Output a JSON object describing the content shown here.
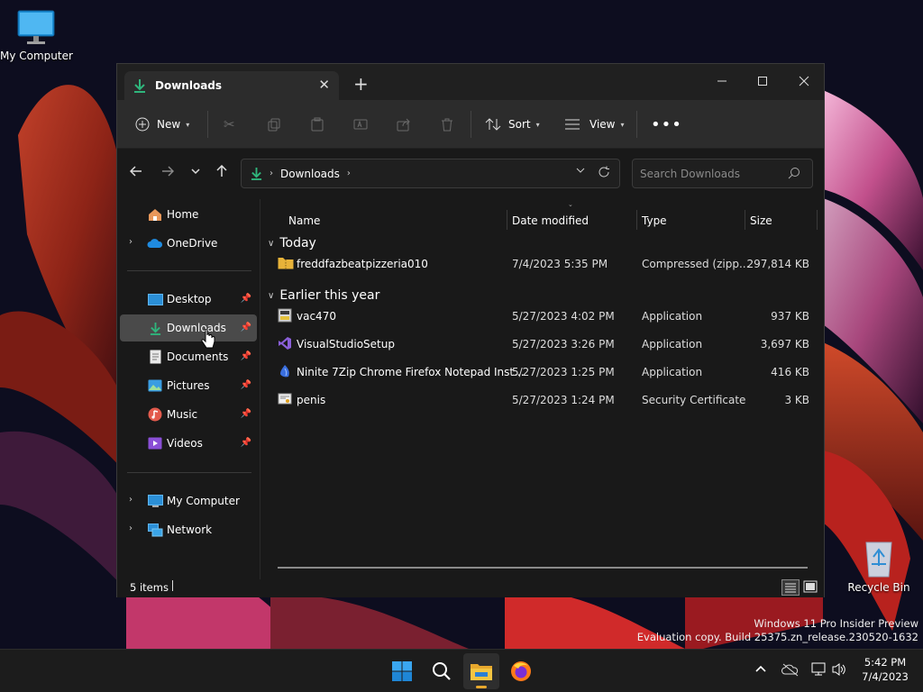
{
  "desktop": {
    "icons": [
      {
        "label": "My Computer"
      },
      {
        "label": "Recycle Bin"
      }
    ],
    "watermark": {
      "line1": "Windows 11 Pro Insider Preview",
      "line2": "Evaluation copy. Build 25375.zn_release.230520-1632"
    }
  },
  "window": {
    "tab_title": "Downloads",
    "commands": {
      "new_label": "New",
      "sort_label": "Sort",
      "view_label": "View"
    },
    "address": {
      "segments": [
        "Downloads"
      ]
    },
    "search": {
      "placeholder": "Search Downloads"
    },
    "nav": {
      "items": [
        {
          "label": "Home"
        },
        {
          "label": "OneDrive"
        },
        {
          "label": "Desktop"
        },
        {
          "label": "Downloads"
        },
        {
          "label": "Documents"
        },
        {
          "label": "Pictures"
        },
        {
          "label": "Music"
        },
        {
          "label": "Videos"
        },
        {
          "label": "My Computer"
        },
        {
          "label": "Network"
        }
      ],
      "selected": "Downloads"
    },
    "columns": [
      "Name",
      "Date modified",
      "Type",
      "Size"
    ],
    "groups": [
      {
        "title": "Today",
        "files": [
          {
            "name": "freddfazbeatpizzeria010",
            "date": "7/4/2023 5:35 PM",
            "type": "Compressed (zipp...",
            "size": "297,814 KB",
            "icon": "zip-folder-icon"
          }
        ]
      },
      {
        "title": "Earlier this year",
        "files": [
          {
            "name": "vac470",
            "date": "5/27/2023 4:02 PM",
            "type": "Application",
            "size": "937 KB",
            "icon": "app-installer-icon"
          },
          {
            "name": "VisualStudioSetup",
            "date": "5/27/2023 3:26 PM",
            "type": "Application",
            "size": "3,697 KB",
            "icon": "visual-studio-icon"
          },
          {
            "name": "Ninite 7Zip Chrome Firefox Notepad Inst...",
            "date": "5/27/2023 1:25 PM",
            "type": "Application",
            "size": "416 KB",
            "icon": "ninite-icon"
          },
          {
            "name": "penis",
            "date": "5/27/2023 1:24 PM",
            "type": "Security Certificate",
            "size": "3 KB",
            "icon": "certificate-icon"
          }
        ]
      }
    ],
    "status": {
      "item_count": "5 items"
    }
  },
  "taskbar": {
    "clock": {
      "time": "5:42 PM",
      "date": "7/4/2023"
    }
  },
  "colors": {
    "accent": "#60cdff",
    "download_green": "#2fb67c",
    "folder_yellow": "#e8b339",
    "window_bg": "#191919",
    "commandbar_bg": "#2c2c2c"
  }
}
